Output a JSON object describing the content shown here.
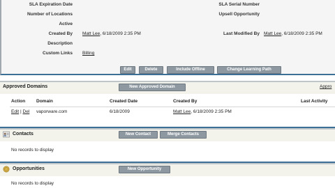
{
  "detail": {
    "rows": [
      {
        "label": "SLA Expiration Date",
        "value": "",
        "label2": "SLA Serial Number",
        "value2": ""
      },
      {
        "label": "Number of Locations",
        "value": "",
        "label2": "Upsell Opportunity",
        "value2": ""
      },
      {
        "label": "Active",
        "value": "",
        "label2": "",
        "value2": ""
      },
      {
        "label": "Created By",
        "value_user": "Matt Lee",
        "value": ", 6/18/2009 2:35 PM",
        "label2": "Last Modified By",
        "value2_user": "Matt Lee",
        "value2": ", 6/18/2009 2:35 PM"
      },
      {
        "label": "Description",
        "value": "",
        "label2": "",
        "value2": ""
      },
      {
        "label": "Custom Links",
        "value_link": "Billing",
        "value": "",
        "label2": "",
        "value2": ""
      }
    ],
    "buttons": [
      "Edit",
      "Delete",
      "Include Offline",
      "Change Learning Path"
    ]
  },
  "approved_domains": {
    "title": "Approved Domains",
    "button": "New Approved Domain",
    "help_link": "Appro",
    "columns": [
      "Action",
      "Domain",
      "Created Date",
      "Created By",
      "Last Activity"
    ],
    "row": {
      "edit": "Edit",
      "sep": " | ",
      "del": "Del",
      "domain": "vaporware.com",
      "created_date": "6/18/2009",
      "created_by_user": "Matt Lee",
      "created_by_rest": ", 6/18/2009 2:35 PM"
    }
  },
  "contacts": {
    "title": "Contacts",
    "buttons": [
      "New Contact",
      "Merge Contacts"
    ],
    "empty": "No records to display"
  },
  "opportunities": {
    "title": "Opportunities",
    "button": "New Opportunity",
    "empty": "No records to display"
  }
}
